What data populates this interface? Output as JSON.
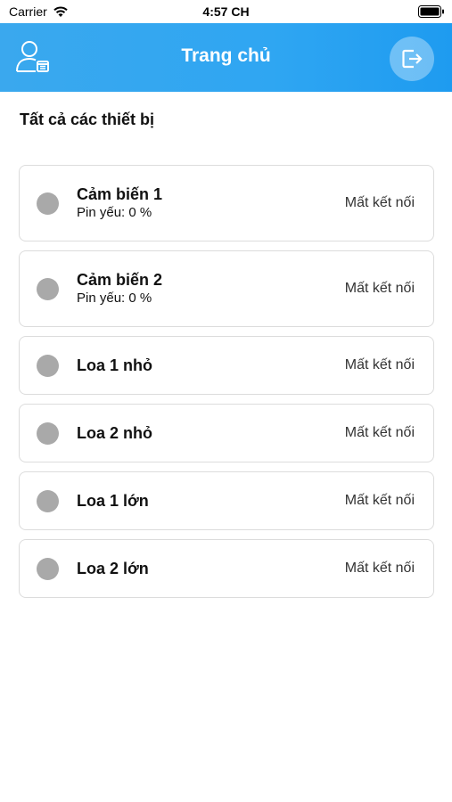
{
  "status_bar": {
    "carrier": "Carrier",
    "time": "4:57 CH"
  },
  "header": {
    "title": "Trang chủ",
    "profile_icon": "user-settings-icon",
    "logout_icon": "logout-icon",
    "gradient_start": "#3aa8ee",
    "gradient_end": "#1e9bf0"
  },
  "section": {
    "title": "Tất cả các thiết bị"
  },
  "devices": [
    {
      "name": "Cảm biến 1",
      "sub": "Pin yếu: 0 %",
      "state": "Mất kết nối",
      "dot_color": "#a9a9a9"
    },
    {
      "name": "Cảm biến 2",
      "sub": "Pin yếu: 0 %",
      "state": "Mất kết nối",
      "dot_color": "#a9a9a9"
    },
    {
      "name": "Loa 1 nhỏ",
      "state": "Mất kết nối",
      "dot_color": "#a9a9a9"
    },
    {
      "name": "Loa 2 nhỏ",
      "state": "Mất kết nối",
      "dot_color": "#a9a9a9"
    },
    {
      "name": "Loa 1 lớn",
      "state": "Mất kết nối",
      "dot_color": "#a9a9a9"
    },
    {
      "name": "Loa 2 lớn",
      "state": "Mất kết nối",
      "dot_color": "#a9a9a9"
    }
  ]
}
